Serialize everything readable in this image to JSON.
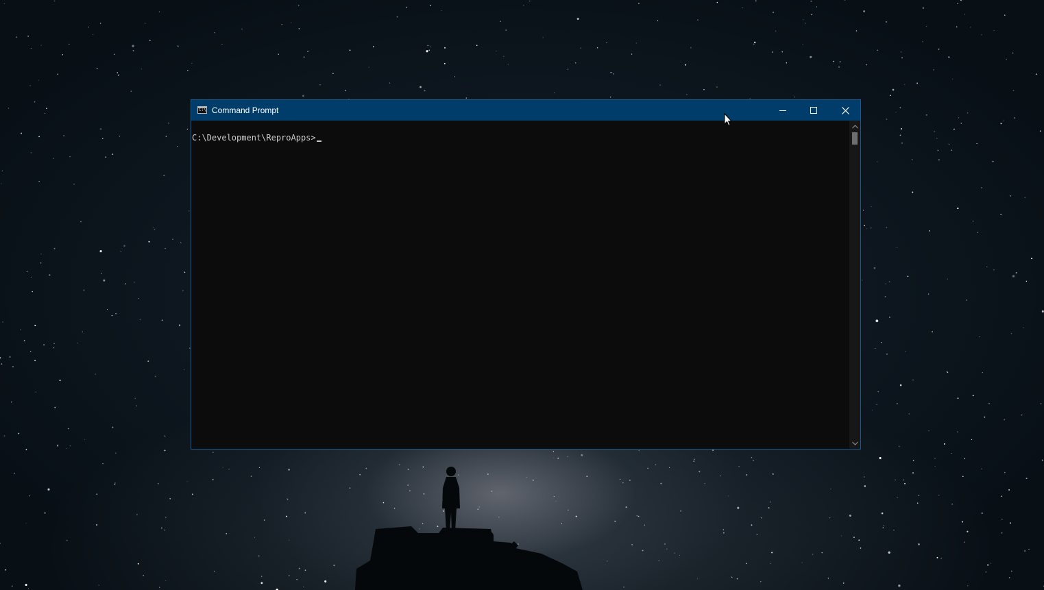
{
  "window": {
    "title": "Command Prompt",
    "icon": "console-icon",
    "icon_glyph": "C:\\",
    "controls": {
      "minimize": "minimize-icon",
      "maximize": "maximize-icon",
      "close": "close-icon"
    }
  },
  "console": {
    "prompt": "C:\\Development\\ReproApps>"
  },
  "scrollbar": {
    "up": "chevron-up-icon",
    "down": "chevron-down-icon"
  },
  "colors": {
    "titlebar": "#003d6b",
    "console_bg": "#0c0c0c",
    "console_text": "#cccccc",
    "border": "#1b5a8e"
  }
}
